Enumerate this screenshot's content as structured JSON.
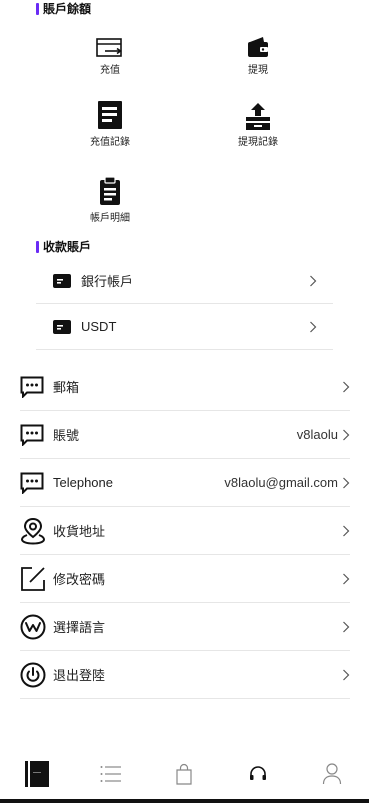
{
  "balance_section": {
    "title": "賬戶餘額",
    "actions": [
      {
        "label": "充值",
        "icon": "card-deposit-icon"
      },
      {
        "label": "提現",
        "icon": "wallet-icon"
      },
      {
        "label": "充值記錄",
        "icon": "document-icon"
      },
      {
        "label": "提現記錄",
        "icon": "upload-tray-icon"
      },
      {
        "label": "帳戶明細",
        "icon": "clipboard-icon"
      }
    ]
  },
  "receive_section": {
    "title": "收款賬戶",
    "accounts": [
      {
        "label": "銀行帳戶",
        "icon": "card-icon"
      },
      {
        "label": "USDT",
        "icon": "card-icon"
      }
    ]
  },
  "menu": [
    {
      "label": "郵箱",
      "value": "",
      "icon": "message-icon"
    },
    {
      "label": "賬號",
      "value": "v8laolu",
      "icon": "message-icon"
    },
    {
      "label": "Telephone",
      "value": "v8laolu@gmail.com",
      "icon": "message-icon"
    },
    {
      "label": "收貨地址",
      "value": "",
      "icon": "location-pin-icon"
    },
    {
      "label": "修改密碼",
      "value": "",
      "icon": "edit-icon"
    },
    {
      "label": "選擇語言",
      "value": "",
      "icon": "language-icon"
    },
    {
      "label": "退出登陸",
      "value": "",
      "icon": "power-icon"
    }
  ],
  "tabbar": [
    {
      "name": "home",
      "icon": "book-icon",
      "active": true
    },
    {
      "name": "list",
      "icon": "list-icon"
    },
    {
      "name": "cart",
      "icon": "bag-icon"
    },
    {
      "name": "support",
      "icon": "headset-icon"
    },
    {
      "name": "profile",
      "icon": "user-icon"
    }
  ],
  "colors": {
    "accent": "#6a2bf5",
    "text": "#111111",
    "divider": "#e6e6e6"
  }
}
